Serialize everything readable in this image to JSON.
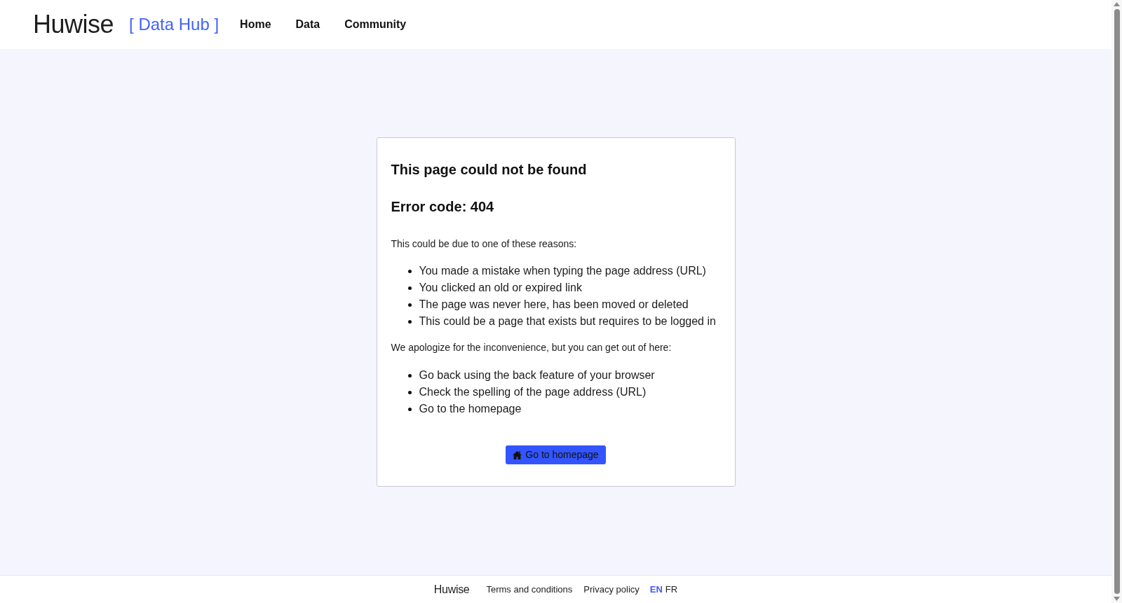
{
  "header": {
    "logo": "Huwise",
    "product": "[ Data Hub ]",
    "nav": [
      "Home",
      "Data",
      "Community"
    ]
  },
  "error_card": {
    "title": "This page could not be found",
    "error_code": "Error code: 404",
    "reasons_intro": "This could be due to one of these reasons:",
    "reasons": [
      "You made a mistake when typing the page address (URL)",
      "You clicked an old or expired link",
      "The page was never here, has been moved or deleted",
      "This could be a page that exists but requires to be logged in"
    ],
    "options_intro": "We apologize for the inconvenience, but you can get out of here:",
    "options": [
      "Go back using the back feature of your browser",
      "Check the spelling of the page address (URL)",
      "Go to the homepage"
    ],
    "button": "Go to homepage"
  },
  "footer": {
    "logo": "Huwise",
    "links": [
      "Terms and conditions",
      "Privacy policy"
    ],
    "languages": [
      {
        "label": "EN",
        "selected": true
      },
      {
        "label": "FR",
        "selected": false
      }
    ]
  }
}
